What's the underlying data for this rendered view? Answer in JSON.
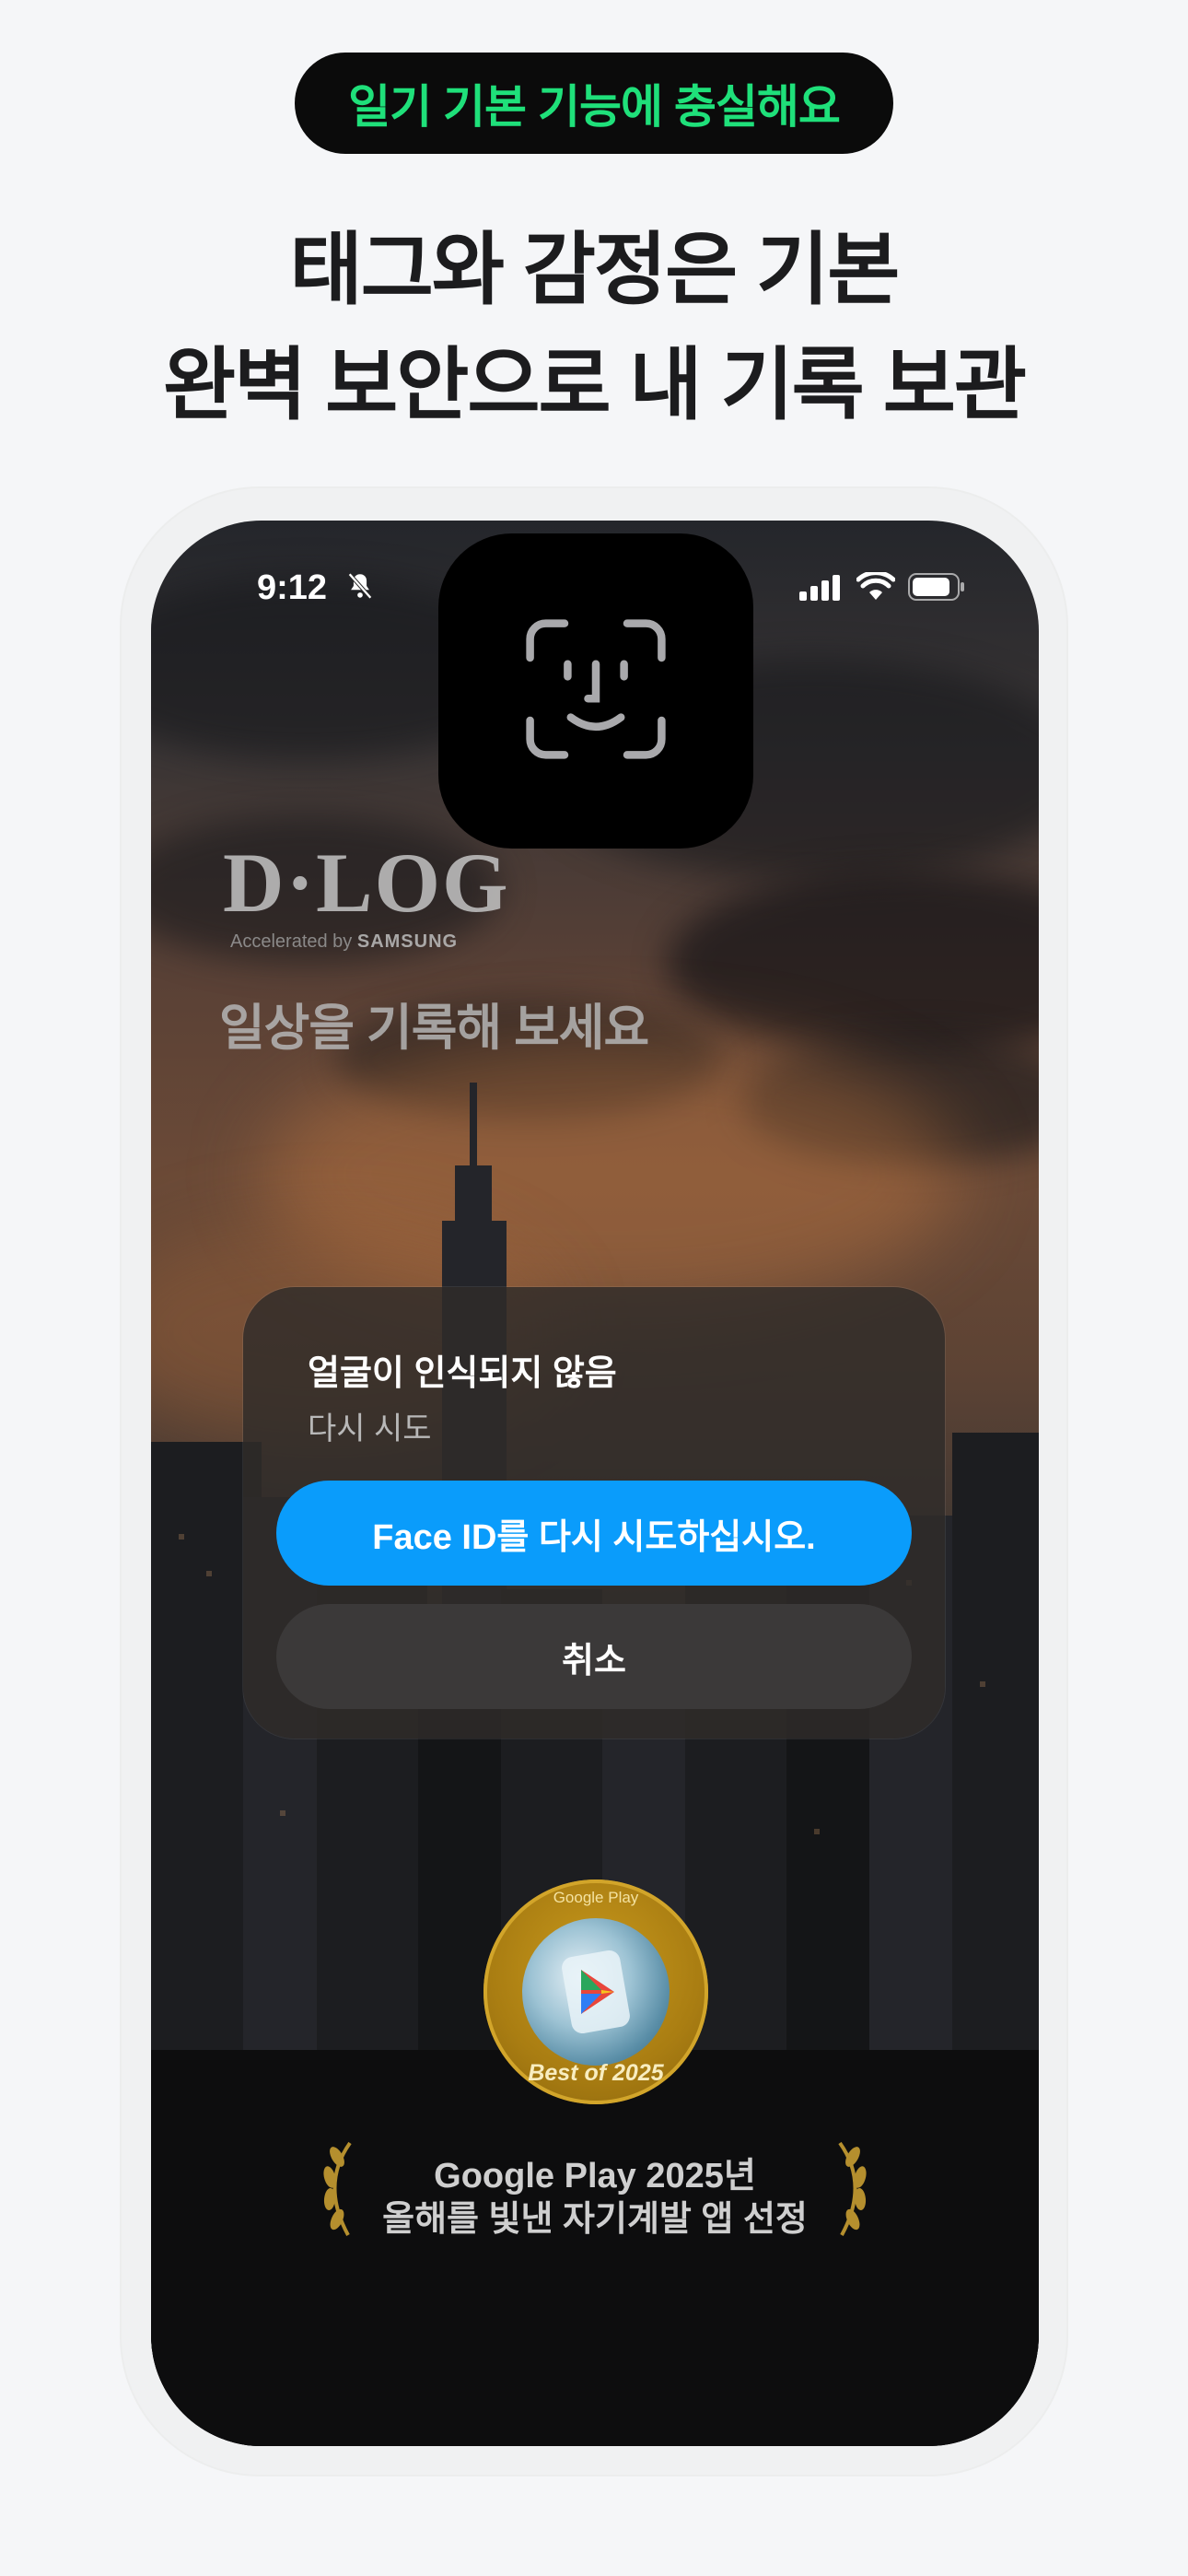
{
  "banner": {
    "pill_label": "일기 기본 기능에 충실해요",
    "headline_line1": "태그와 감정은 기본",
    "headline_line2": "완벽 보안으로 내 기록 보관"
  },
  "status_bar": {
    "time": "9:12",
    "icons": [
      "bell-slash-icon",
      "signal-icon",
      "wifi-icon",
      "battery-icon"
    ]
  },
  "app": {
    "logo": "D·LOG",
    "logo_sub_prefix": "Accelerated by",
    "logo_sub_brand": "SAMSUNG",
    "tagline": "일상을 기록해 보세요"
  },
  "faceid": {
    "icon": "face-id-icon"
  },
  "dialog": {
    "title": "얼굴이 인식되지 않음",
    "subtitle": "다시 시도",
    "primary_button": "Face ID를 다시 시도하십시오.",
    "cancel_button": "취소"
  },
  "award": {
    "badge_top": "Google Play",
    "badge_bottom": "Best of 2025",
    "line1": "Google Play 2025년",
    "line2": "올해를 빛낸 자기계발 앱 선정"
  },
  "colors": {
    "accent_green": "#1fe07a",
    "primary_blue": "#0a9cfb",
    "background": "#f5f6f8"
  }
}
